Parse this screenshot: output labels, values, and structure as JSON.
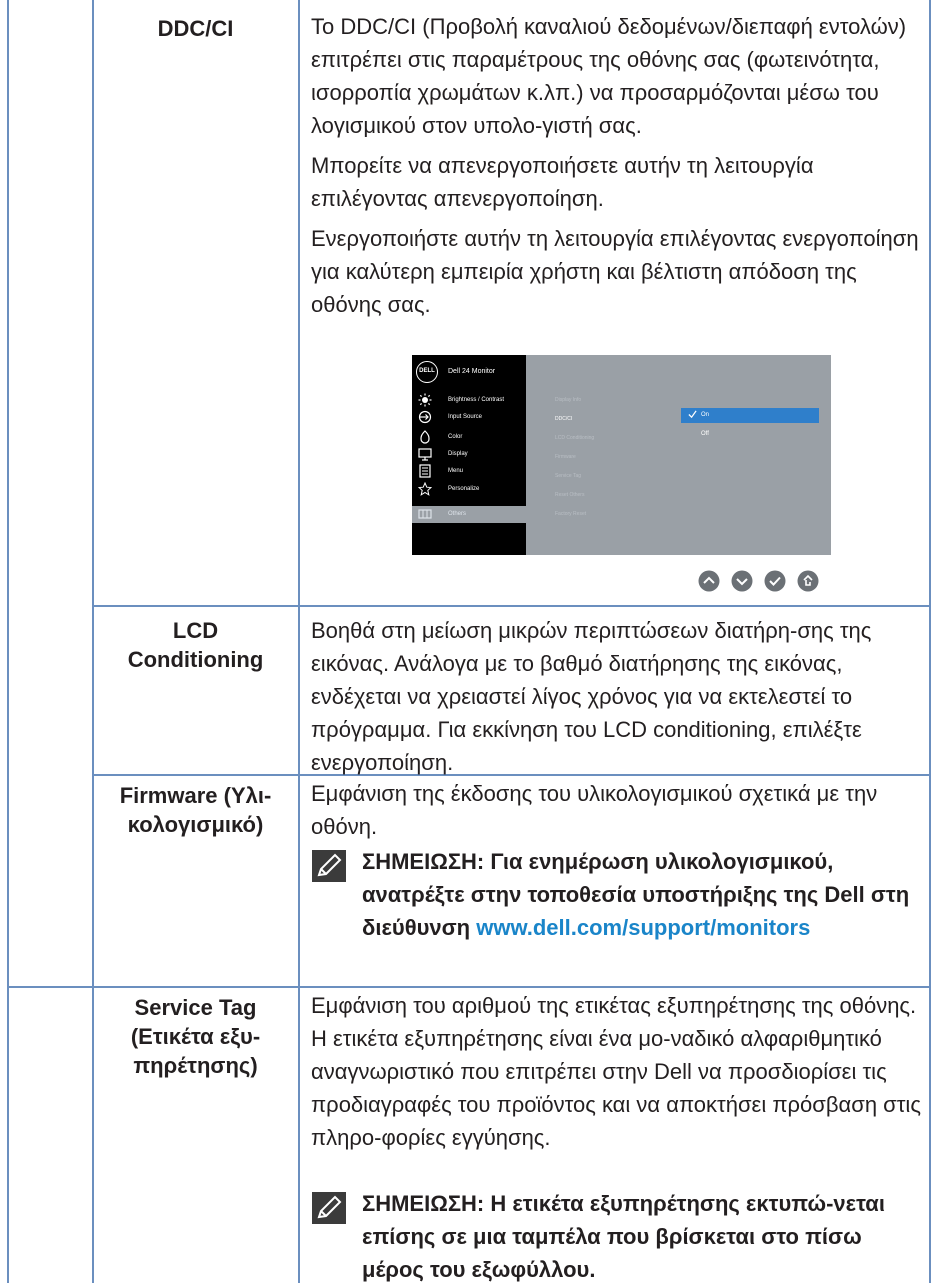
{
  "rows": {
    "ddc": {
      "label": "DDC/CI",
      "paragraphs": [
        "Το DDC/CI (Προβολή καναλιού δεδομένων/διεπαφή εντολών) επιτρέπει στις παραμέτρους της οθόνης σας (φωτεινότητα, ισορροπία χρωμάτων κ.λπ.) να προσαρμόζονται μέσω του λογισμικού στον υπολο-γιστή σας.",
        "Μπορείτε να απενεργοποιήσετε αυτήν τη λειτουργία επιλέγοντας απενεργοποίηση.",
        "Ενεργοποιήστε αυτήν τη λειτουργία επιλέγοντας ενεργοποίηση για καλύτερη εμπειρία χρήστη και βέλτιστη απόδοση της οθόνης σας."
      ]
    },
    "lcd": {
      "label_line1": "LCD",
      "label_line2": "Conditioning",
      "text": "Βοηθά στη μείωση μικρών περιπτώσεων διατήρη-σης της εικόνας. Ανάλογα με το βαθμό διατήρησης της εικόνας, ενδέχεται να χρειαστεί λίγος χρόνος για να εκτελεστεί το πρόγραμμα. Για εκκίνηση του LCD conditioning, επιλέξτε ενεργοποίηση."
    },
    "firmware": {
      "label_line1": "Firmware (Υλι-",
      "label_line2": "κολογισμικό)",
      "text": "Εμφάνιση της έκδοσης του υλικολογισμικού σχετικά με την οθόνη.",
      "note_prefix": "ΣΗΜΕΙΩΣΗ: Για ενημέρωση υλικολογισμικού, ανατρέξτε στην τοποθεσία υποστήριξης της Dell στη διεύθυνση ",
      "note_link": "www.dell.com/support/monitors"
    },
    "service": {
      "label_line1": "Service Tag",
      "label_line2": "(Ετικέτα εξυ-",
      "label_line3": "πηρέτησης)",
      "text": "Εμφάνιση του αριθμού της ετικέτας εξυπηρέτησης της οθόνης. Η ετικέτα εξυπηρέτησης είναι ένα μο-ναδικό αλφαριθμητικό αναγνωριστικό που επιτρέπει στην Dell να προσδιορίσει τις προδιαγραφές του προϊόντος και να αποκτήσει πρόσβαση στις πληρο-φορίες εγγύησης.",
      "note": "ΣΗΜΕΙΩΣΗ: Η ετικέτα εξυπηρέτησης εκτυπώ-νεται επίσης σε μια ταμπέλα που βρίσκεται στο πίσω μέρος του εξωφύλλου."
    }
  },
  "osd": {
    "logo": "DELL",
    "title": "Dell 24 Monitor",
    "menu": [
      {
        "label": "Brightness / Contrast",
        "icon": "brightness-icon"
      },
      {
        "label": "Input Source",
        "icon": "input-source-icon"
      },
      {
        "label": "Color",
        "icon": "color-icon"
      },
      {
        "label": "Display",
        "icon": "display-icon"
      },
      {
        "label": "Menu",
        "icon": "menu-icon"
      },
      {
        "label": "Personalize",
        "icon": "star-icon"
      },
      {
        "label": "Others",
        "icon": "others-icon"
      }
    ],
    "submenu": [
      "Display Info",
      "DDC/CI",
      "LCD Conditioning",
      "Firmware",
      "Service Tag",
      "Reset Others",
      "Factory Reset"
    ],
    "options": [
      "On",
      "Off"
    ],
    "buttons": [
      "up-button-icon",
      "down-button-icon",
      "check-button-icon",
      "exit-button-icon"
    ]
  },
  "colors": {
    "border": "#6b8fbf",
    "link": "#1a85c9",
    "osd_highlight": "#2f7fcb"
  }
}
